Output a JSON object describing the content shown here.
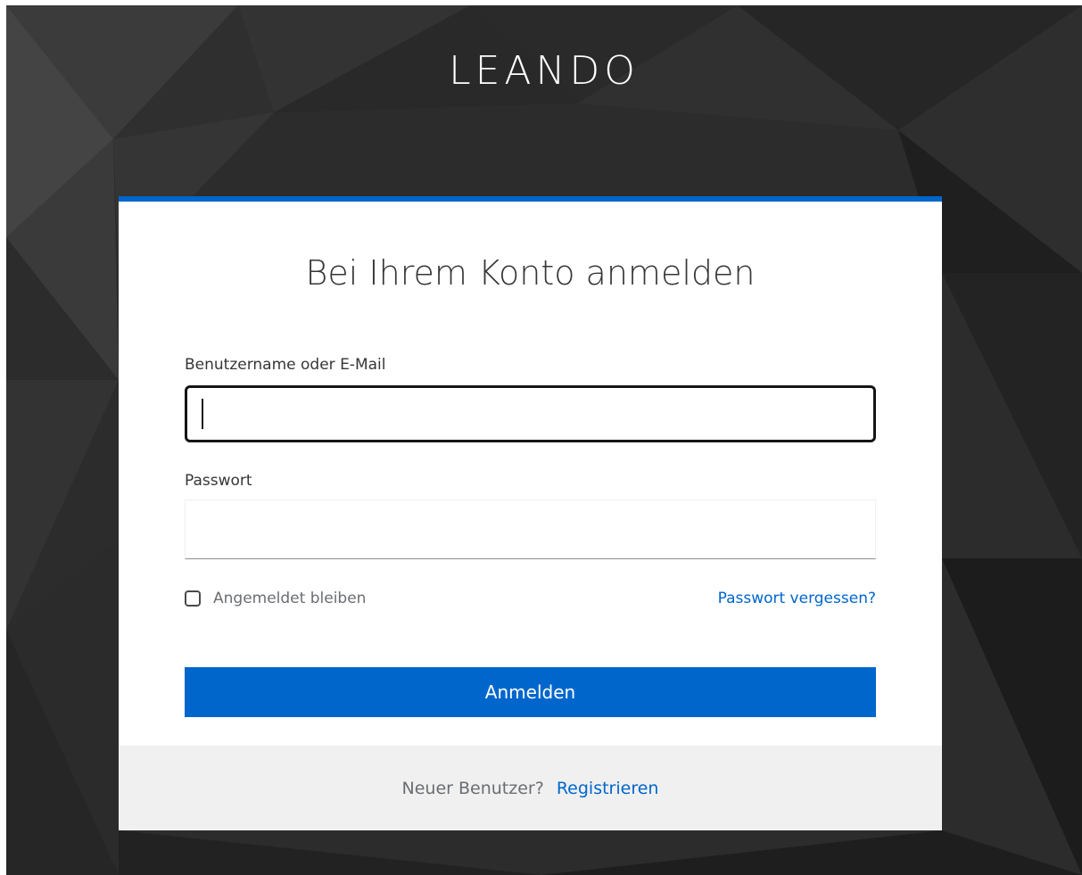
{
  "brand": {
    "name": "LEANDO"
  },
  "login": {
    "title": "Bei Ihrem Konto anmelden",
    "username": {
      "label": "Benutzername oder E-Mail",
      "value": ""
    },
    "password": {
      "label": "Passwort",
      "value": ""
    },
    "remember_me": {
      "label": "Angemeldet bleiben",
      "checked": false
    },
    "forgot_password": "Passwort vergessen?",
    "submit_label": "Anmelden"
  },
  "footer": {
    "new_user_text": "Neuer Benutzer?",
    "register_link": "Registrieren"
  },
  "colors": {
    "accent": "#0066cc",
    "background_dark": "#2c2c2c",
    "card_footer_bg": "#f0f0f0",
    "text_primary": "#363636",
    "text_muted": "#6a6e73"
  },
  "icons": {
    "checkbox": "checkbox-unchecked-icon"
  }
}
